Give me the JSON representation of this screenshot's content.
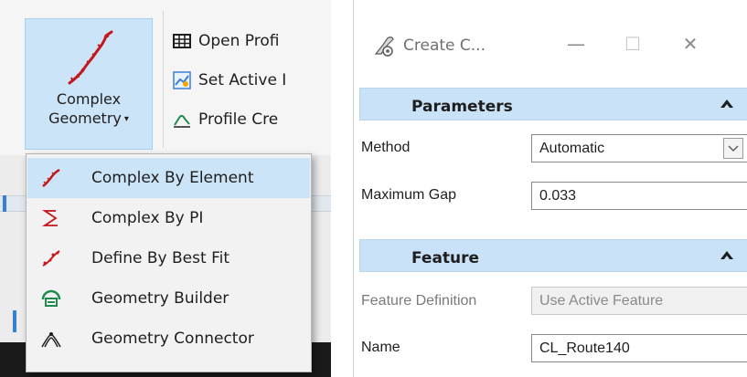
{
  "ribbon": {
    "big_button": {
      "line1": "Complex",
      "line2": "Geometry",
      "caret": "▾",
      "icon": "complex-geometry-icon"
    },
    "items": [
      {
        "label": "Open Profi",
        "icon": "grid-table-icon"
      },
      {
        "label": "Set Active I",
        "icon": "set-active-profile-icon"
      },
      {
        "label": "Profile Cre",
        "icon": "profile-curve-icon"
      }
    ]
  },
  "menu": {
    "items": [
      {
        "label": "Complex By Element",
        "icon": "complex-by-element-icon",
        "highlighted": true
      },
      {
        "label": "Complex By PI",
        "icon": "complex-by-pi-icon"
      },
      {
        "label": "Define By Best Fit",
        "icon": "best-fit-icon"
      },
      {
        "label": "Geometry Builder",
        "icon": "geometry-builder-icon"
      },
      {
        "label": "Geometry Connector",
        "icon": "geometry-connector-icon"
      }
    ]
  },
  "dialog": {
    "title": "Create C...",
    "controls": {
      "minimize": "—",
      "maximize": "☐",
      "close": "✕"
    },
    "sections": {
      "parameters": {
        "title": "Parameters",
        "method_label": "Method",
        "method_value": "Automatic",
        "max_gap_label": "Maximum Gap",
        "max_gap_value": "0.033"
      },
      "feature": {
        "title": "Feature",
        "feature_definition_label": "Feature Definition",
        "feature_definition_value": "Use Active Feature",
        "name_label": "Name",
        "name_value": "CL_Route140"
      }
    }
  },
  "colors": {
    "highlight": "#cce4f7",
    "section_header": "#c9e2f7",
    "icon_red": "#c4161c",
    "icon_green": "#1f8a4c"
  }
}
